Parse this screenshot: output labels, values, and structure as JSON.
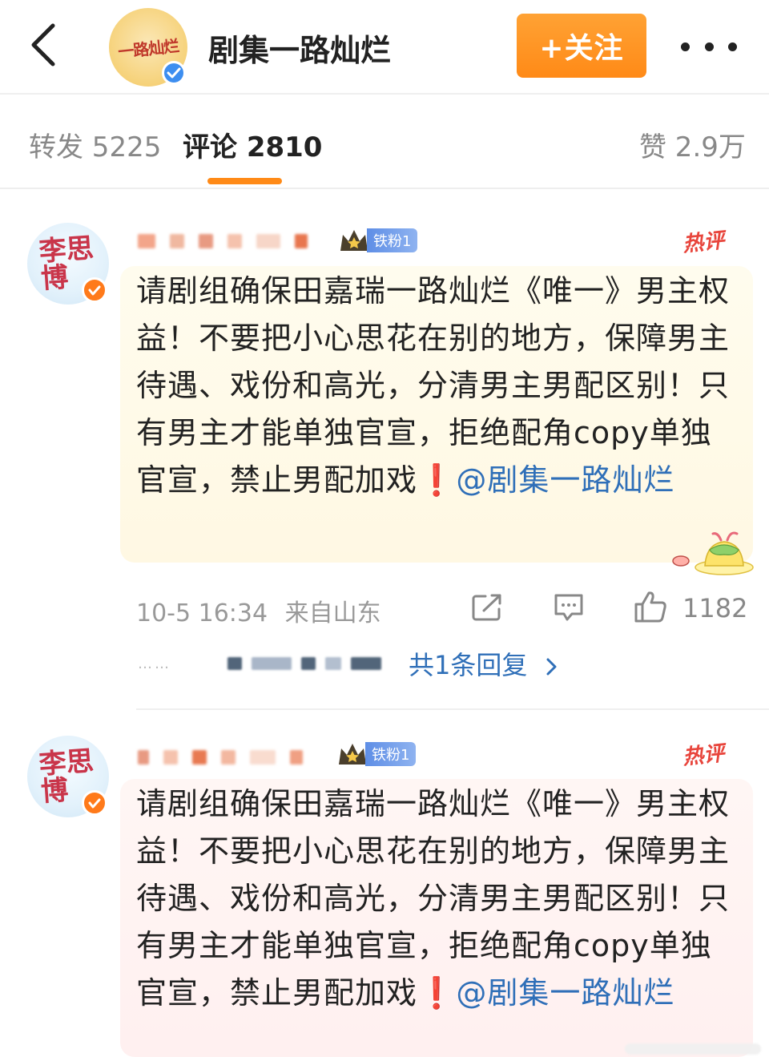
{
  "header": {
    "account_name": "剧集一路灿烂",
    "avatar_text": "一路灿烂",
    "follow_label": "+关注"
  },
  "tabs": {
    "reposts": "转发 5225",
    "comments": "评论 2810",
    "likes": "赞 2.9万"
  },
  "comments": [
    {
      "avatar_text": "李思博",
      "fan_badge": "铁粉1",
      "hot_tag": "热评",
      "text_main": "请剧组确保田嘉瑞一路灿烂《唯一》男主权益！不要把小心思花在别的地方，保障男主待遇、戏份和高光，分清男主男配区别！只有男主才能单独官宣，拒绝配角copy单独官宣，禁止男配加戏",
      "warn_mark": "❗",
      "mention": "@剧集一路灿烂",
      "time": "10-5 16:34",
      "location": "来自山东",
      "likes": "1182",
      "reply_link": "共1条回复"
    },
    {
      "avatar_text": "李思博",
      "fan_badge": "铁粉1",
      "hot_tag": "热评",
      "text_main": "请剧组确保田嘉瑞一路灿烂《唯一》男主权益！不要把小心思花在别的地方，保障男主待遇、戏份和高光，分清男主男配区别！只有男主才能单独官宣，拒绝配角copy单独官宣，禁止男配加戏",
      "warn_mark": "❗",
      "mention": "@剧集一路灿烂"
    }
  ],
  "colors": {
    "accent_orange": "#ff8a17",
    "link_blue": "#2f6fb8",
    "hot_red": "#e8453c",
    "comment_bg_1": "#fffbea",
    "comment_bg_2": "#fff3f3"
  },
  "icons": [
    "back-arrow-icon",
    "verified-icon",
    "more-icon",
    "share-icon",
    "comment-icon",
    "like-icon",
    "chevron-right-icon",
    "crown-icon",
    "pudding-sticker-icon"
  ]
}
